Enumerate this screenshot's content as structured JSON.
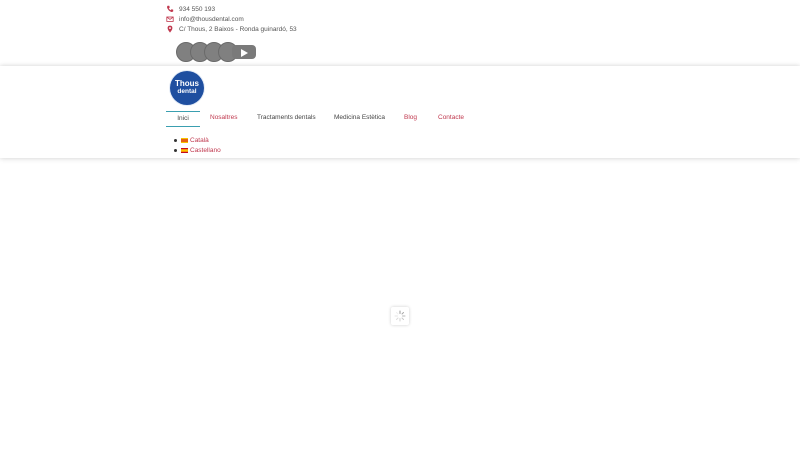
{
  "contact": {
    "phone": "934 550 193",
    "email": "info@thousdental.com",
    "address": "C/ Thous, 2 Baixos - Ronda guinardó, 53"
  },
  "social": {
    "icons": [
      "facebook-icon",
      "twitter-icon",
      "instagram-icon",
      "youtube-icon"
    ]
  },
  "logo": {
    "line1": "Thous",
    "line2": "dental"
  },
  "nav": {
    "items": [
      {
        "label": "Inici",
        "active": true
      },
      {
        "label": "Nosaltres"
      },
      {
        "label": "Tractaments dentals"
      },
      {
        "label": "Medicina Estètica"
      },
      {
        "label": "Blog"
      },
      {
        "label": "Contacte"
      }
    ]
  },
  "languages": [
    {
      "label": "Català"
    },
    {
      "label": "Castellano"
    }
  ],
  "colors": {
    "accent": "#c0384e",
    "active_underline": "#3a9fb0",
    "logo_blue": "#1f4fa0",
    "text": "#555555"
  }
}
